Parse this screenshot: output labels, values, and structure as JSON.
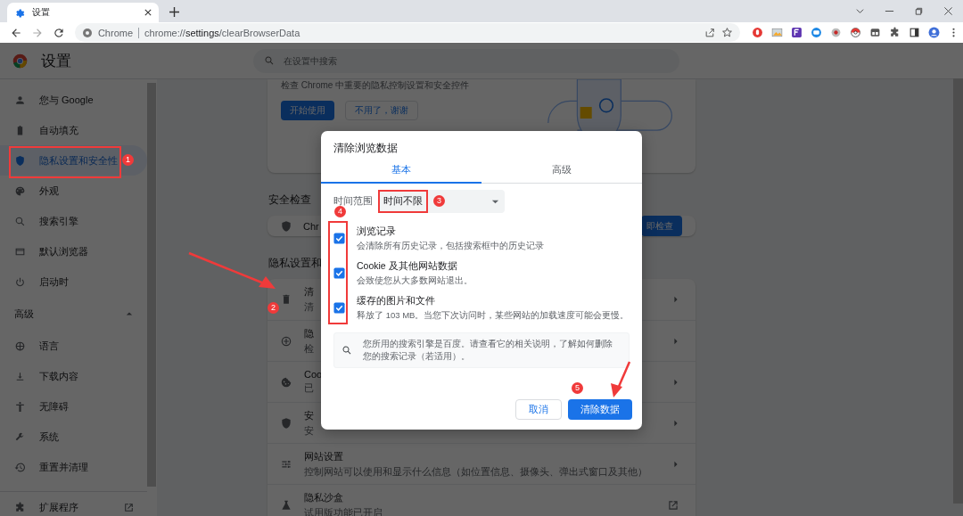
{
  "browser_tab": {
    "title": "设置"
  },
  "address_bar": {
    "chip": "Chrome",
    "url": "chrome://**settings**/clearBrowserData"
  },
  "settings_header": {
    "title": "设置",
    "search": {
      "placeholder": "在设置中搜索"
    }
  },
  "sidebar": {
    "items": [
      {
        "label": "您与 Google",
        "selected": false
      },
      {
        "label": "自动填充",
        "selected": false
      },
      {
        "label": "隐私设置和安全性",
        "selected": true,
        "marker": "1",
        "outlined": true
      },
      {
        "label": "外观",
        "selected": false
      },
      {
        "label": "搜索引擎",
        "selected": false
      },
      {
        "label": "默认浏览器",
        "selected": false
      },
      {
        "label": "启动时",
        "selected": false
      }
    ],
    "advanced": {
      "label": "高级",
      "expanded": true
    },
    "advanced_items": [
      {
        "label": "语言",
        "selected": false
      },
      {
        "label": "下载内容",
        "selected": false
      },
      {
        "label": "无障碍",
        "selected": false
      },
      {
        "label": "系统",
        "selected": false
      },
      {
        "label": "重置并清理",
        "selected": false
      }
    ],
    "extensions": {
      "label": "扩展程序"
    }
  },
  "privacy_guide": {
    "text": "检查 Chrome 中重要的隐私控制设置和安全控件",
    "buttons": [
      {
        "label": "开始使用",
        "kind": "primary"
      },
      {
        "label": "不用了，谢谢",
        "kind": "secondary"
      }
    ]
  },
  "safety_check": {
    "heading": "安全检查",
    "text": "Chr",
    "button": "即检查"
  },
  "privacy_section": {
    "heading": "隐私设置和",
    "rows": [
      {
        "title": "清",
        "subtitle": "清",
        "kind": "submenu",
        "marker": "2"
      },
      {
        "title": "隐",
        "subtitle": "检",
        "kind": "submenu"
      },
      {
        "title": "Coo",
        "subtitle": "已",
        "kind": "submenu"
      },
      {
        "title": "安",
        "subtitle": "安",
        "kind": "submenu"
      },
      {
        "title": "网站设置",
        "subtitle": "控制网站可以使用和显示什么信息（如位置信息、摄像头、弹出式窗口及其他）",
        "kind": "submenu"
      },
      {
        "title": "隐私沙盒",
        "subtitle": "试用版功能已开启",
        "kind": "external"
      }
    ]
  },
  "dialog": {
    "title": "清除浏览数据",
    "tabs": [
      {
        "label": "基本",
        "selected": true
      },
      {
        "label": "高级",
        "selected": false
      }
    ],
    "time_range": {
      "label": "时间范围",
      "value": "时间不限",
      "marker": "3",
      "outlined": true
    },
    "options_marker": "4",
    "options_outlined": true,
    "options": [
      {
        "title": "浏览记录",
        "subtitle": "会清除所有历史记录，包括搜索框中的历史记录",
        "checked": true
      },
      {
        "title": "Cookie 及其他网站数据",
        "subtitle": "会致使您从大多数网站退出。",
        "checked": true
      },
      {
        "title": "缓存的图片和文件",
        "subtitle": "释放了 103 MB。当您下次访问时，某些网站的加载速度可能会更慢。",
        "checked": true
      }
    ],
    "notice": "您所用的搜索引擎是百度。请查看它的相关说明，了解如何删除您的搜索记录（若适用）。",
    "buttons": [
      {
        "label": "取消",
        "kind": "secondary"
      },
      {
        "label": "清除数据",
        "kind": "primary",
        "marker": "5"
      }
    ]
  }
}
